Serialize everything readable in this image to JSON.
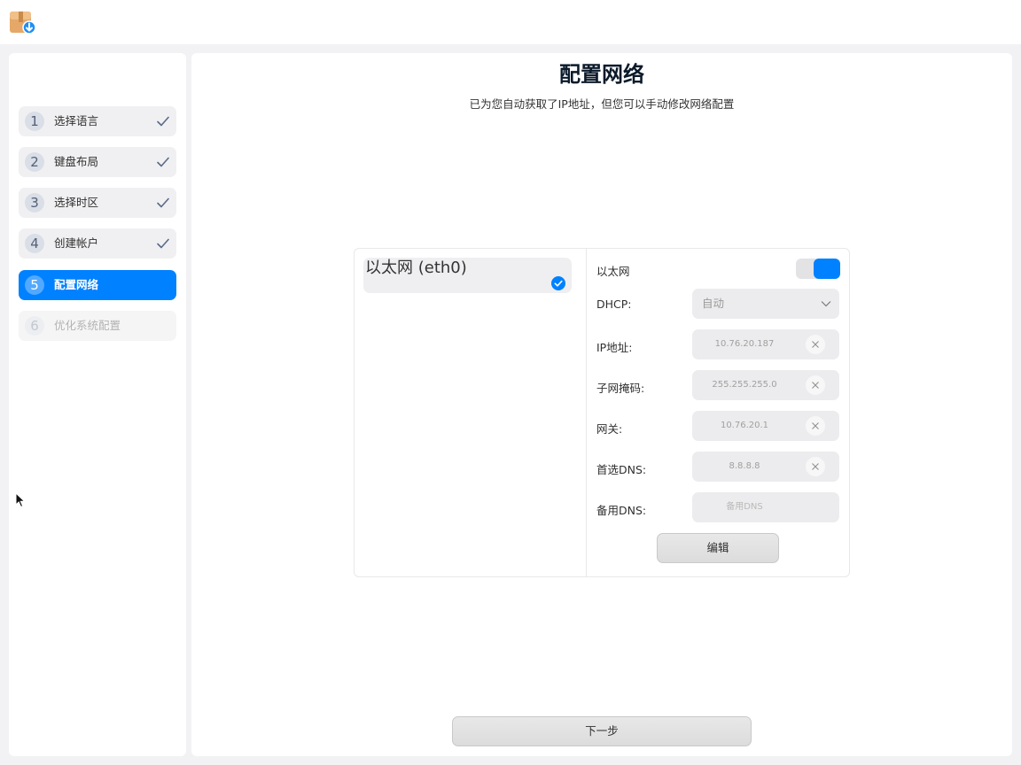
{
  "colors": {
    "accent": "#0081ff",
    "background": "#f2f2f4",
    "panel": "#ffffff"
  },
  "titlebar": {
    "app_icon": "installer-package-icon"
  },
  "sidebar": {
    "steps": [
      {
        "num": "1",
        "label": "选择语言",
        "state": "done",
        "icon": "check-icon"
      },
      {
        "num": "2",
        "label": "键盘布局",
        "state": "done",
        "icon": "check-icon"
      },
      {
        "num": "3",
        "label": "选择时区",
        "state": "done",
        "icon": "check-icon"
      },
      {
        "num": "4",
        "label": "创建帐户",
        "state": "done",
        "icon": "check-icon"
      },
      {
        "num": "5",
        "label": "配置网络",
        "state": "active"
      },
      {
        "num": "6",
        "label": "优化系统配置",
        "state": "disabled"
      }
    ]
  },
  "main": {
    "title": "配置网络",
    "subtitle": "已为您自动获取了IP地址，但您可以手动修改网络配置",
    "interface": {
      "name": "以太网 (eth0)",
      "selected": true
    },
    "form": {
      "ethernet_label": "以太网",
      "ethernet_enabled": true,
      "dhcp_label": "DHCP:",
      "dhcp_value": "自动",
      "ip_label": "IP地址:",
      "ip_value": "10.76.20.187",
      "mask_label": "子网掩码:",
      "mask_value": "255.255.255.0",
      "gateway_label": "网关:",
      "gateway_value": "10.76.20.1",
      "dns1_label": "首选DNS:",
      "dns1_value": "8.8.8.8",
      "dns2_label": "备用DNS:",
      "dns2_placeholder": "备用DNS"
    },
    "edit_label": "编辑",
    "next_label": "下一步"
  }
}
